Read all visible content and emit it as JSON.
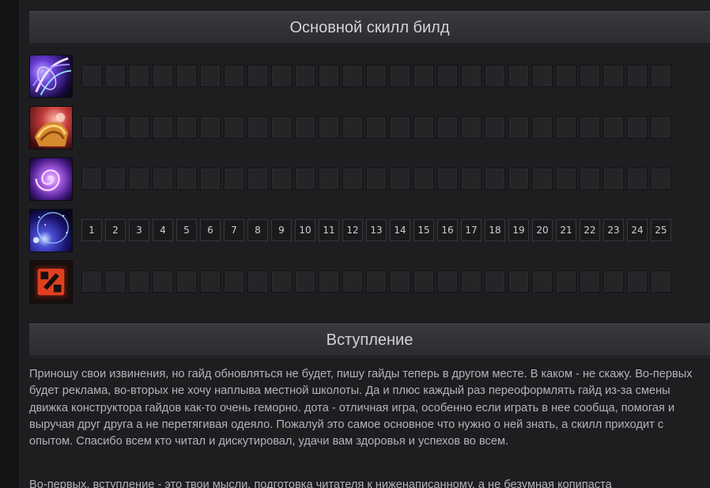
{
  "sections": {
    "skill_build_title": "Основной скилл билд",
    "intro_title": "Вступление"
  },
  "skill_rows": [
    {
      "icon": "purple-wave-icon",
      "levels": []
    },
    {
      "icon": "golden-armor-icon",
      "levels": []
    },
    {
      "icon": "purple-vortex-icon",
      "levels": []
    },
    {
      "icon": "night-sky-orb-icon",
      "levels": [
        "1",
        "2",
        "3",
        "4",
        "5",
        "6",
        "7",
        "8",
        "9",
        "10",
        "11",
        "12",
        "13",
        "14",
        "15",
        "16",
        "17",
        "18",
        "19",
        "20",
        "21",
        "22",
        "23",
        "24",
        "25"
      ]
    },
    {
      "icon": "dota-logo-icon",
      "levels": []
    }
  ],
  "intro": {
    "paragraph1": "Приношу свои извинения, но гайд обновляться не будет, пишу гайды теперь в другом месте. В каком - не скажу. Во-первых будет реклама, во-вторых не хочу наплыва местной школоты. Да и плюс каждый раз переоформлять гайд из-за смены движка конструктора гайдов как-то очень геморно.   дота - отличная игра, особенно если играть в нее сообща, помогая и выручая друг друга а не перетягивая одеяло. Пожалуй это самое основное что нужно о ней знать, а скилл приходит с опытом. Спасибо всем кто читал и дискутировал, удачи вам здоровья и успехов во всем.",
    "paragraph2": "Во-первых, вступление - это твои мысли, подготовка читателя к ниженаписанному, а не безумная копипаста"
  },
  "colors": {
    "background": "#1e1e21",
    "header_bg": "#333337",
    "text": "#b4b4b8"
  }
}
